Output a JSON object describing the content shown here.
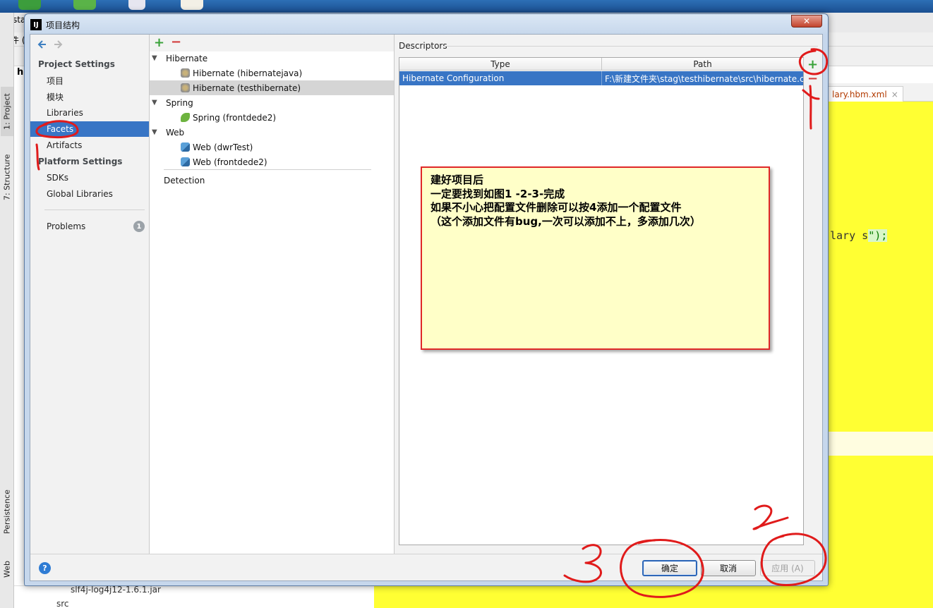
{
  "background_ide": {
    "title_fragment": "sta",
    "menu_fragment": "文件 (",
    "project_fragment": "h",
    "left_tabs": [
      "1: Project",
      "7: Structure",
      "Persistence",
      "Web"
    ],
    "editor_tab": "lary.hbm.xml",
    "editor_tab_close": "×",
    "code_text": "lary s",
    "code_text_tail": "\");",
    "tree_file": "slf4j-log4j12-1.6.1.jar",
    "tree_folder": "src"
  },
  "dialog": {
    "title": "项目结构",
    "app_icon": "IJ",
    "close_glyph": "✕"
  },
  "nav": {
    "project_settings_header": "Project Settings",
    "project_settings_items": [
      "项目",
      "模块",
      "Libraries",
      "Facets",
      "Artifacts"
    ],
    "selected_item": "Facets",
    "platform_settings_header": "Platform Settings",
    "platform_settings_items": [
      "SDKs",
      "Global Libraries"
    ],
    "problems_label": "Problems",
    "problems_count": "1"
  },
  "facets_tree": {
    "add_glyph": "+",
    "remove_glyph": "−",
    "groups": [
      {
        "label": "Hibernate",
        "children": [
          "Hibernate (hibernatejava)",
          "Hibernate (testhibernate)"
        ]
      },
      {
        "label": "Spring",
        "children": [
          "Spring (frontdede2)"
        ]
      },
      {
        "label": "Web",
        "children": [
          "Web (dwrTest)",
          "Web (frontdede2)"
        ]
      }
    ],
    "selected": "Hibernate (testhibernate)",
    "detection_label": "Detection"
  },
  "descriptors": {
    "section_label": "Descriptors",
    "columns": [
      "Type",
      "Path"
    ],
    "rows": [
      {
        "type": "Hibernate Configuration",
        "path": "F:\\新建文件夹\\stag\\testhibernate\\src\\hibernate.cfg"
      }
    ],
    "add_glyph": "+",
    "remove_glyph": "−"
  },
  "note": {
    "lines": [
      "建好项目后",
      "一定要找到如图1 -2-3-完成",
      "如果不小心把配置文件删除可以按4添加一个配置文件",
      "（这个添加文件有bug,一次可以添加不上，多添加几次）"
    ]
  },
  "buttons": {
    "help": "?",
    "ok": "确定",
    "cancel": "取消",
    "apply": "应用 (A)"
  },
  "annotations": {
    "stroke_color": "#e01b1b",
    "labels": [
      "1",
      "2",
      "3",
      "4"
    ]
  },
  "colors": {
    "selection": "#3875c5",
    "editor_background": "#ffff33",
    "note_background": "#ffffc8",
    "note_border": "#e02828"
  }
}
